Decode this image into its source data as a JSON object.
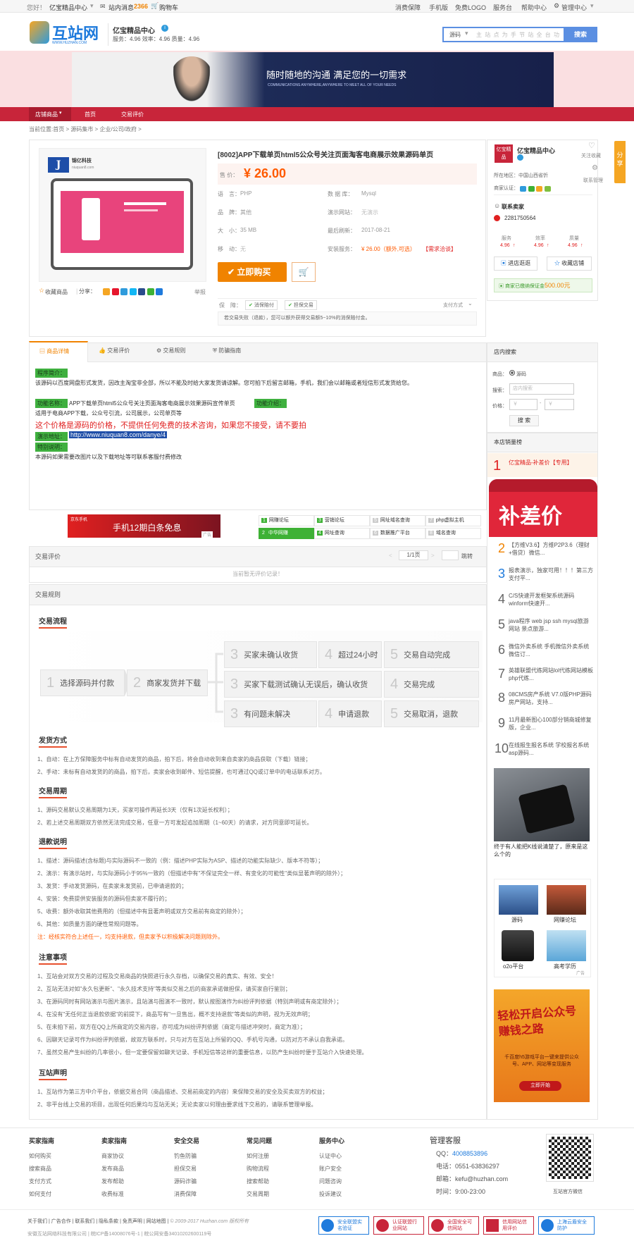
{
  "topbar": {
    "greeting": "您好！",
    "seller": "亿宝精品中心",
    "mail_prefix": "站内消息",
    "mail_count": "2366",
    "cart": "购物车",
    "links": [
      "消费保障",
      "手机版",
      "免费LOGO",
      "服务台",
      "帮助中心",
      "管理中心"
    ]
  },
  "logo": {
    "cn": "互站网",
    "en": "WWW.HUZHAN.COM"
  },
  "shop_header": {
    "name": "亿宝精品中心",
    "ratings": "服务：4.96  效率：4.96  质量：4.96"
  },
  "search": {
    "select": "源码",
    "placeholder": "主 站 点 为 手 节 站 全 台 功",
    "button": "搜索"
  },
  "banner": {
    "line1": "随时随地的沟通 满足您的一切需求",
    "line2": "COMMUNICATIONS ANYWHERE,ANYWHERE TO MEET ALL OF YOUR NEEDS"
  },
  "nav": [
    "店铺商品",
    "首页",
    "交易评价"
  ],
  "breadcrumb": "当前位置:首页 > 源码集市 > 企业/公司/政府 >",
  "product": {
    "title": "[8002]APP下载单页html5公众号关注页面淘客电商展示效果源码单页",
    "price_label": "售 价：",
    "price": "¥ 26.00",
    "specs": [
      [
        "语　言：",
        "PHP"
      ],
      [
        "数 据 库：",
        "Mysql"
      ],
      [
        "品　牌：",
        "其他"
      ],
      [
        "演示网站：",
        "无演示"
      ],
      [
        "大　小：",
        "35 MB"
      ],
      [
        "最后刷新：",
        "2017-08-21"
      ],
      [
        "移　动：",
        "无"
      ],
      [
        "安装服务：",
        "¥ 26.00（额外,可选）"
      ]
    ],
    "install_extra": "【需求洽谈】",
    "buy": "立即购买",
    "guarantee_label": "保　障：",
    "guarantees": [
      "消保赔付",
      "担保交易"
    ],
    "pay": "支付方式",
    "note": "若交易失败（退款），您可以额外获得交易额5~10%的消保赔付金。",
    "fav": "收藏商品",
    "share": "分享：",
    "report": "举报",
    "thumb_brand": "锦亿科技",
    "thumb_url": "niuquan8.com"
  },
  "seller_card": {
    "badge": "亿宝精品",
    "name": "亿宝精品中心",
    "fav": "关注收藏",
    "manage": "联系管理",
    "region": "所在地区：中国山西省忻",
    "auth": "商家认证：",
    "contact": "联系卖家",
    "qq": "2281750564",
    "stats": [
      [
        "服务",
        "4.96"
      ],
      [
        "效率",
        "4.96"
      ],
      [
        "质量",
        "4.96"
      ]
    ],
    "enter": "进店逛逛",
    "collect": "收藏店铺",
    "deposit_prefix": "商家已缴纳保证金",
    "deposit": "500.00元"
  },
  "share_tab": "分享",
  "tabs": [
    "商品详情",
    "交易评价",
    "交易规则",
    "防骗指南"
  ],
  "detail": {
    "tag1": "程序简介：",
    "p1": "该源码以百度网盘形式发货，因改主淘宝非全部，所以不能及时给大家发货请谅解。您可拍下后留言邮箱，手机，我们会以邮箱或者短信形式发货给您。",
    "p2a": "APP下载单页html5公众号关注页面淘客电商展示效果源码宣传单页",
    "tag2": "功能介绍：",
    "p2b": "适用于电商APP下载，公众号引流，公司展示，公司单页等",
    "red": "这个价格是源码的价格，不提供任何免费的技术咨询，如果您不接受，请不要拍",
    "tag3": "演示地址：",
    "url": "http://www.niuquan8.com/danye/4",
    "tag4": "特别说明：",
    "p3": "本源码如果需要改图片以及下载地址等可联系客服付费修改"
  },
  "ad": {
    "title": "手机12期白条免息",
    "brand": "京东手机",
    "label": "广告"
  },
  "quicklinks": [
    [
      "1",
      "网赚论坛"
    ],
    [
      "3",
      "营销论坛"
    ],
    [
      "5",
      "网址域名查询"
    ],
    [
      "7",
      "php虚拟主机"
    ],
    [
      "2",
      "中华网赚"
    ],
    [
      "4",
      "网址查询"
    ],
    [
      "6",
      "数据推广平台"
    ],
    [
      "8",
      "域名查询"
    ]
  ],
  "review": {
    "label": "交易评价",
    "pager": "1/1页",
    "jump": "跳转",
    "empty": "当前暂无评价记录！"
  },
  "rules": {
    "label": "交易规则",
    "flow_title": "交易流程",
    "steps": [
      [
        "1",
        "选择源码并付款"
      ],
      [
        "2",
        "商家发货并下载"
      ],
      [
        "3",
        "买家未确认收货"
      ],
      [
        "4",
        "超过24小时"
      ],
      [
        "5",
        "交易自动完成"
      ],
      [
        "3",
        "买家下载测试确认无误后，确认收货"
      ],
      [
        "4",
        "交易完成"
      ],
      [
        "3",
        "有问题未解决"
      ],
      [
        "4",
        "申请退款"
      ],
      [
        "5",
        "交易取消，退款"
      ]
    ],
    "sections": [
      {
        "title": "发货方式",
        "lines": [
          "1、自动：在上方保障服务中标有自动发货的商品，拍下后，将会自动收到来自卖家的商品获取（下载）链接；",
          "2、手动：未标有自动发货的的商品，拍下后，卖家会收到邮件、短信提醒，也可通过QQ或订单中的电话联系对方。"
        ]
      },
      {
        "title": "交易周期",
        "lines": [
          "1、源码交易默认交易周期为1天，买家可操作再延长3天（仅有1次延长权利）；",
          "2、若上述交易周期双方依然无法完成交易，任意一方可发起追加周期（1~60天）的请求，对方同意即可延长。"
        ]
      },
      {
        "title": "退款说明",
        "lines": [
          "1、描述：源码描述(含标题)与实际源码不一致的（例：描述PHP实际为ASP、描述的功能实际缺少、版本不符等）；",
          "2、演示：有演示站时，与实际源码小于95%一致的（但描述中有\"不保证完全一样、有变化的可能性\"类似显著声明的除外）；",
          "3、发货：手动发货源码，在卖家未发货前，已申请退款的；",
          "4、安装：免费提供安装服务的源码但卖家不履行的；",
          "5、收费：额外收取其他费用的（但描述中有显著声明或双方交易前有商定的除外）；",
          "6、其他：如质量方面的硬性常规问题等。"
        ],
        "note": "注：经核实符合上述任一，均支持退款，但卖家予以积极解决问题则除外。"
      },
      {
        "title": "注意事项",
        "lines": [
          "1、互站会对双方交易的过程及交易商品的快照进行永久存档，以确保交易的真实、有效、安全！",
          "2、互站无法对如\"永久包更新\"、\"永久技术支持\"等类似交易之后的商家承诺做担保，请买家自行鉴别；",
          "3、在源码同时有网站演示与图片演示，且站演与图演不一致时，默认按图演作为纠纷评判依据（特别声明或有商定除外）；",
          "4、在没有\"无任何正当退款依据\"的前提下，商品写有\"一旦售出，概不支持退款\"等类似的声明，视为无效声明；",
          "5、在未拍下前，双方在QQ上所商定的交易内容，亦可成为纠纷评判依据（商定与描述冲突时，商定为准）；",
          "6、因聊天记录可作为纠纷评判依据，故双方联系时，只与对方在互站上所留的QQ、手机号沟通，以防对方不承认自我承诺。",
          "7、虽然交易产生纠纷的几率很小，但一定要保留如聊天记录、手机短信等这样的重要信息，以防产生纠纷时便于互站介入快速处理。"
        ]
      },
      {
        "title": "互站声明",
        "lines": [
          "1、互站作为第三方中介平台，依据交易合同（商品描述、交易前商定的内容）来保障交易的安全及买卖双方的权益；",
          "2、非平台线上交易的项目，出现任何后果均与互站无关；无论卖家以何理由要求线下交易的，请联系管理举报。"
        ]
      }
    ]
  },
  "sidebar": {
    "search_title": "店内搜索",
    "product_label": "商品：",
    "product_opt": "源码",
    "keyword_label": "搜索：",
    "keyword_ph": "店内搜索",
    "price_label": "价格：",
    "price_ph": "￥",
    "btn": "搜 索",
    "sales_title": "本店销量榜",
    "top1": "亿宝精品-补差价【专用】",
    "top1_img": "补差价",
    "ranks": [
      [
        "2",
        "【方维V3.6】方维P2P3.6（理财+借贷）微信..."
      ],
      [
        "3",
        "报表演示，独家可用！！！第三方支付平..."
      ],
      [
        "4",
        "C/S快速开发框架系统源码winform快速开..."
      ],
      [
        "5",
        "java程序 web jsp ssh mysql旅游网站 景点旅游..."
      ],
      [
        "6",
        "微信外卖系统 手机微信外卖系统 微信订..."
      ],
      [
        "7",
        "英雄联盟代练网站lol代练网站模板php代练..."
      ],
      [
        "8",
        "08CMS房产系统 V7.0版PHP源码房产网站，支持..."
      ],
      [
        "9",
        "11月最新图心100部分销商城修复版，企业..."
      ],
      [
        "10",
        "在线报生报名系统 学校报名系统 asp源码..."
      ]
    ],
    "ad_caption": "终于有人能把K线说清楚了，原来是这么个的",
    "grid": [
      "源码",
      "网赚论坛",
      "o2o平台",
      "高考学历"
    ],
    "game_ad": "轻松开启公众号赚钱之路",
    "game_sub": "千百度h5游戏平台一键来提供公众号、APP、网站等变现服务",
    "game_btn": "立即开始",
    "ad_label": "广告"
  },
  "footer": {
    "cols": [
      [
        "买家指南",
        "如何购买",
        "搜索商品",
        "支付方式",
        "如何支付"
      ],
      [
        "卖家指南",
        "商家协议",
        "发布商品",
        "发布帮助",
        "收费标准"
      ],
      [
        "安全交易",
        "钓鱼防骗",
        "担保交易",
        "源码诈骗",
        "消费保障"
      ],
      [
        "常见问题",
        "如何注册",
        "购物流程",
        "搜索帮助",
        "交易周期"
      ],
      [
        "服务中心",
        "认证中心",
        "账户安全",
        "问题咨询",
        "投诉建议"
      ]
    ],
    "service_title": "管理客服",
    "qq_label": "QQ：",
    "qq": "4008853896",
    "tel": "电话：0551-63836297",
    "mail": "邮箱：kefu@huzhan.com",
    "time": "时间：9:00-23:00",
    "qr_caption": "互站官方微信",
    "bottom_links": [
      "关于我们",
      "广告合作",
      "联系我们",
      "隐私条款",
      "免责声明",
      "网站地图"
    ],
    "copyright": "© 2009-2017 Huzhan.com 版权所有",
    "company": "安徽互站网络科技有限公司 | 皖ICP备14008076号-1 | 皖公网安备34010202600119号",
    "badges": [
      "安全联盟实名验证",
      "认证联盟行业网站",
      "全国安全可信网站",
      "信用网站信用评价",
      "上海云盾安全防护"
    ]
  },
  "colors": {
    "accent": "#f08300",
    "nav": "#c8253a",
    "price": "#ff5a00",
    "link_blue": "#1e7adc"
  }
}
